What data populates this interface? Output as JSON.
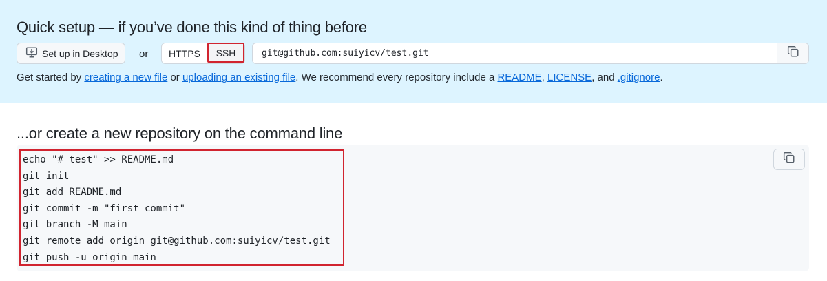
{
  "quick_setup": {
    "title": "Quick setup — if you’ve done this kind of thing before",
    "desktop_button": {
      "label": "Set up in Desktop",
      "icon": "desktop-download-icon"
    },
    "or_label": "or",
    "protocols": [
      {
        "label": "HTTPS",
        "selected": false
      },
      {
        "label": "SSH",
        "selected": true
      }
    ],
    "clone_url": "git@github.com:suiyicv/test.git",
    "copy_icon": "copy-icon",
    "get_started": {
      "prefix": "Get started by ",
      "link_new_file": "creating a new file",
      "or": " or ",
      "link_upload": "uploading an existing file",
      "middle": ". We recommend every repository include a ",
      "link_readme": "README",
      "comma": ", ",
      "link_license": "LICENSE",
      "and": ", and ",
      "link_gitignore": ".gitignore",
      "suffix": "."
    }
  },
  "command_line": {
    "title": "...or create a new repository on the command line",
    "lines": [
      "echo \"# test\" >> README.md",
      "git init",
      "git add README.md",
      "git commit -m \"first commit\"",
      "git branch -M main",
      "git remote add origin git@github.com:suiyicv/test.git",
      "git push -u origin main"
    ],
    "copy_icon": "copy-icon"
  },
  "colors": {
    "quick_setup_bg": "#ddf4ff",
    "link": "#0969da",
    "highlight_border": "#d1242f",
    "code_bg": "#f6f8fa"
  }
}
